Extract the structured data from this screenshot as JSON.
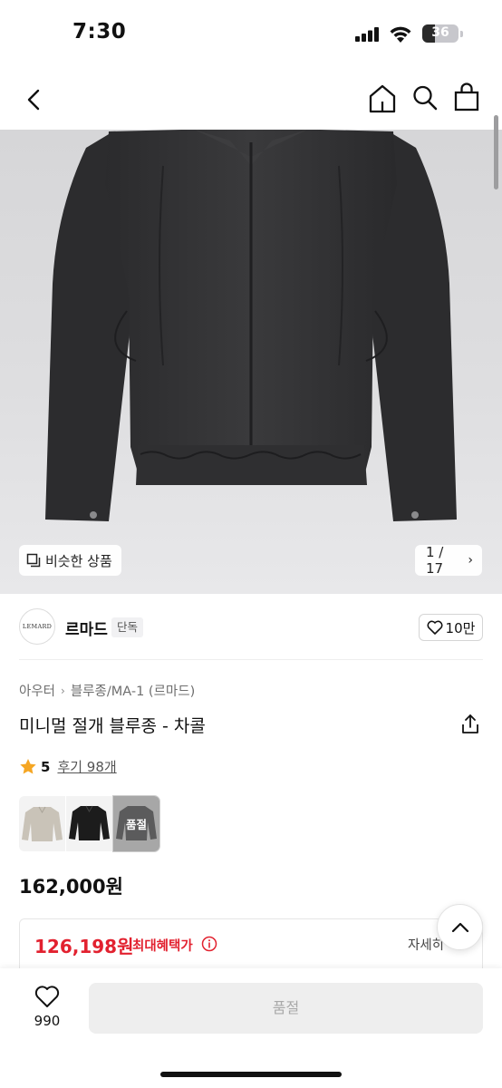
{
  "status_bar": {
    "time": "7:30",
    "battery": "36",
    "battery_level": 0.36
  },
  "nav": {
    "icons": [
      "back-icon",
      "home-icon",
      "search-icon",
      "shopping-bag-icon"
    ]
  },
  "gallery": {
    "similar_label": "비슷한 상품",
    "counter": "1 / 17",
    "chevron": "›"
  },
  "brand": {
    "logo_text": "LEMARD",
    "name": "르마드",
    "badge": "단독",
    "like_count": "10만"
  },
  "breadcrumb": {
    "items": [
      "아우터",
      "블루종/MA-1 (르마드)"
    ],
    "separator": "›"
  },
  "product": {
    "title": "미니멀 절개 블루종 - 차콜",
    "rating": "5",
    "reviews": "후기 98개",
    "price": "162,000원",
    "color_options": [
      {
        "name": "beige",
        "color": "#c9c3b8",
        "sold_out": false
      },
      {
        "name": "black",
        "color": "#1c1c1c",
        "sold_out": false
      },
      {
        "name": "charcoal",
        "color": "#2e2e30",
        "sold_out": true
      }
    ],
    "sold_out_label": "품절"
  },
  "benefit": {
    "price": "126,198원",
    "label": "최대혜택가",
    "detail": "자세히"
  },
  "bottom": {
    "wish_count": "990",
    "buy_label": "품절"
  },
  "colors": {
    "accent_red": "#e2212f",
    "star": "#f5a623"
  }
}
